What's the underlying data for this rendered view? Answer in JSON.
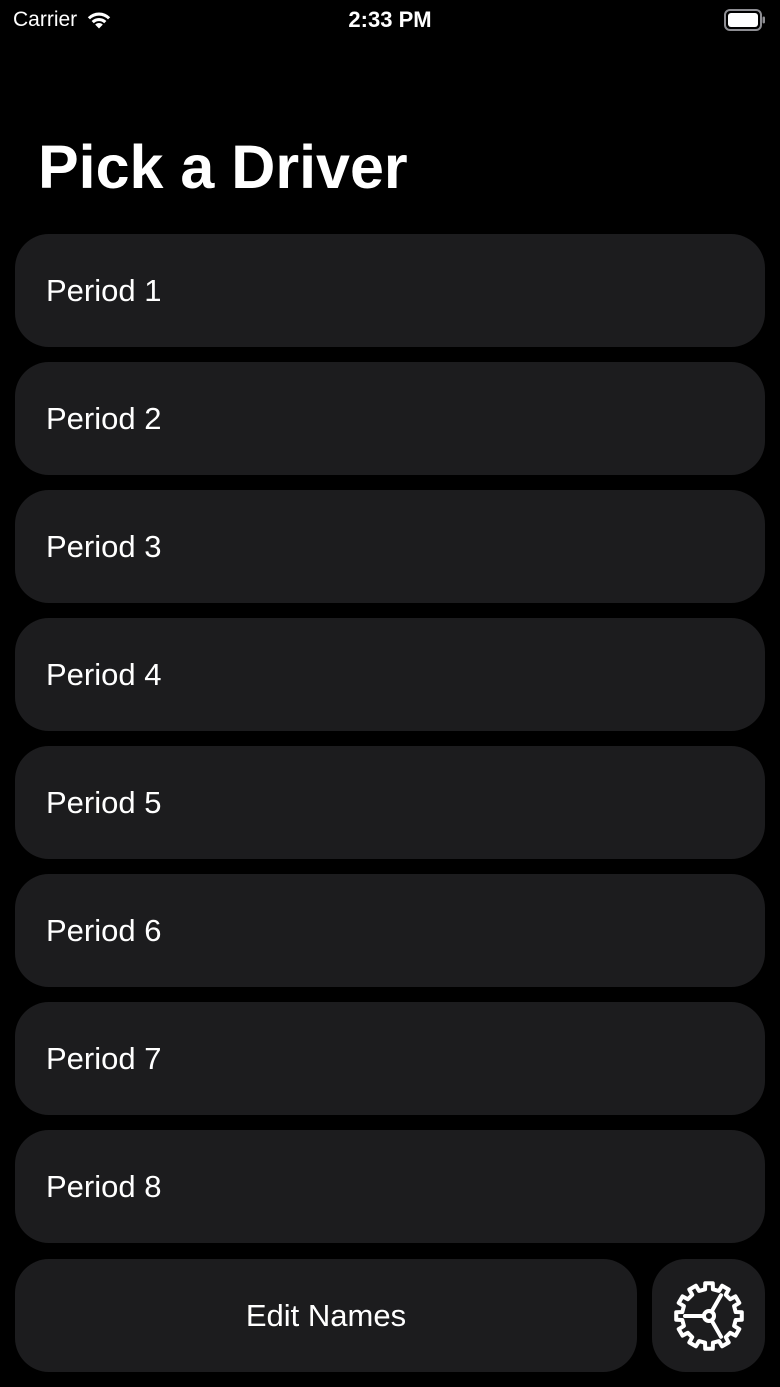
{
  "status_bar": {
    "carrier": "Carrier",
    "time": "2:33 PM",
    "icons": [
      "wifi-icon",
      "battery-icon"
    ]
  },
  "header": {
    "title": "Pick a Driver"
  },
  "periods": [
    {
      "label": "Period 1"
    },
    {
      "label": "Period 2"
    },
    {
      "label": "Period 3"
    },
    {
      "label": "Period 4"
    },
    {
      "label": "Period 5"
    },
    {
      "label": "Period 6"
    },
    {
      "label": "Period 7"
    },
    {
      "label": "Period 8"
    }
  ],
  "footer": {
    "edit_names_label": "Edit Names",
    "settings_icon": "gear-icon"
  },
  "colors": {
    "background": "#000000",
    "card": "#1c1c1e",
    "text": "#ffffff"
  }
}
